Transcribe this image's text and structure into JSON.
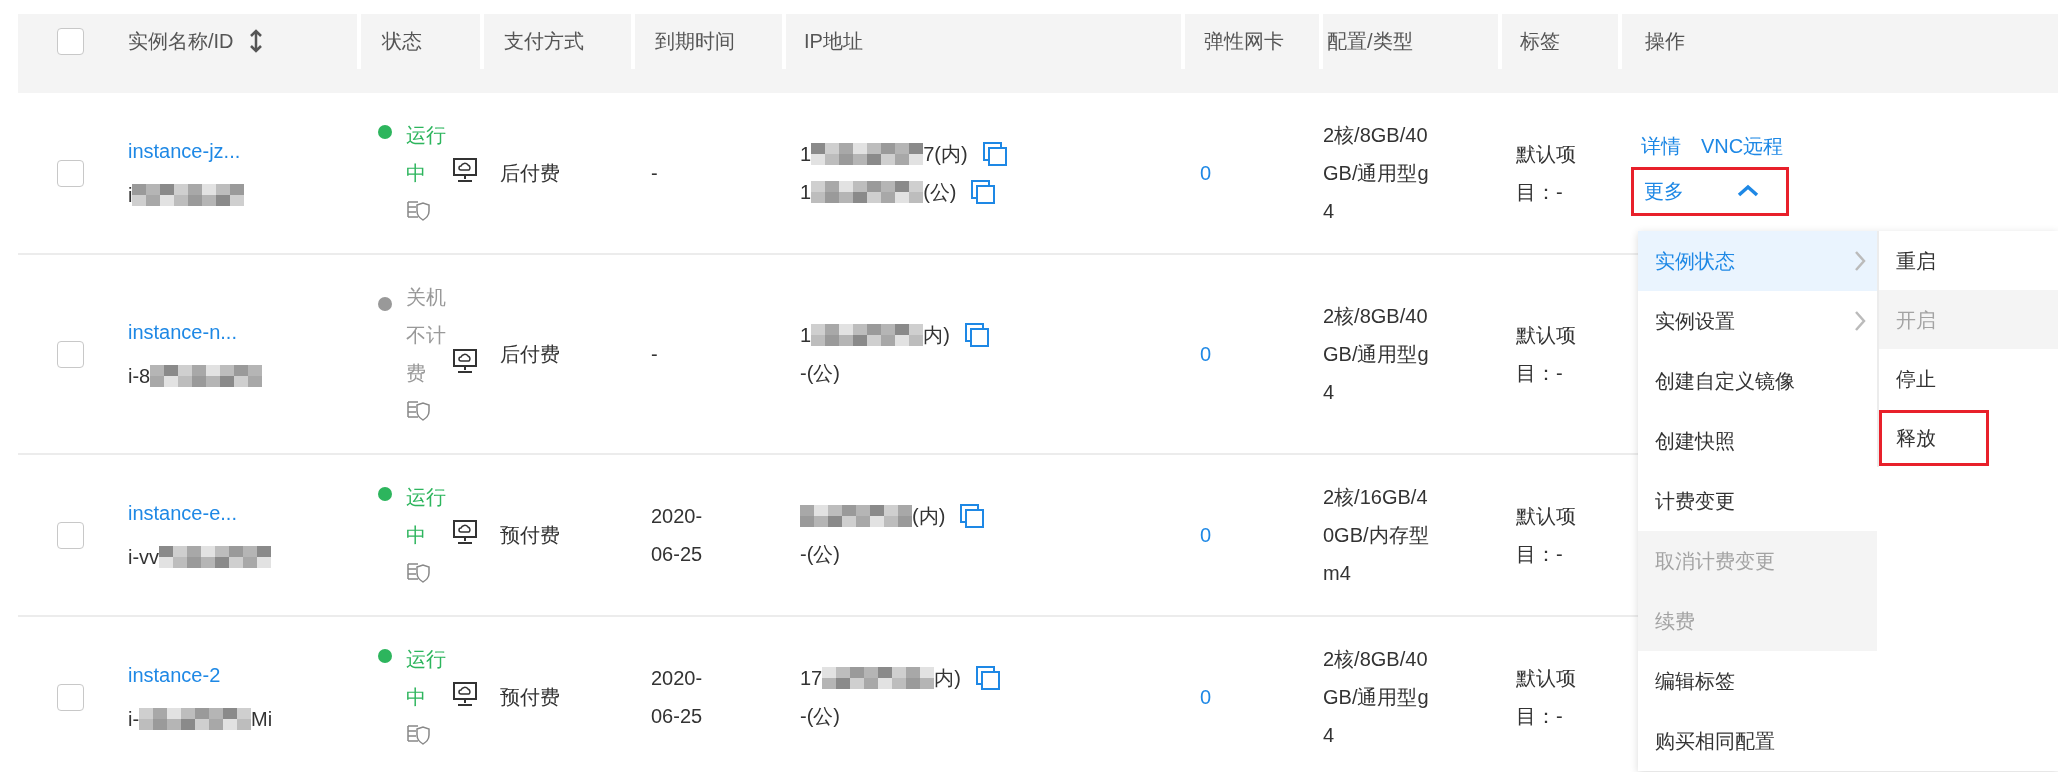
{
  "table": {
    "select_all_checked": false,
    "columns": [
      {
        "label": "实例名称/ID",
        "sortable": true
      },
      {
        "label": "状态",
        "sortable": false
      },
      {
        "label": "支付方式",
        "sortable": false
      },
      {
        "label": "到期时间",
        "sortable": false
      },
      {
        "label": "IP地址",
        "sortable": false
      },
      {
        "label": "弹性网卡",
        "sortable": false
      },
      {
        "label": "配置/类型",
        "sortable": false
      },
      {
        "label": "标签",
        "sortable": false
      },
      {
        "label": "操作",
        "sortable": false
      }
    ],
    "rows": [
      {
        "checked": false,
        "name": "instance-jz...",
        "id_before": "i",
        "id_redacted": true,
        "status": {
          "text": "运行中",
          "color": "#2db55d"
        },
        "payment": "后付费",
        "expiry": "-",
        "ips": [
          {
            "before": "1",
            "redacted": true,
            "after": "7(内)",
            "copyable": true
          },
          {
            "before": "1",
            "redacted": true,
            "after": "(公)",
            "copyable": true
          }
        ],
        "eni": "0",
        "config": "2核/8GB/40GB/通用型g4",
        "tags": "默认项目：-",
        "actions": [
          {
            "kind": "link",
            "label": "详情"
          },
          {
            "kind": "link",
            "label": "VNC远程"
          },
          {
            "kind": "more",
            "label": "更多",
            "expanded": true,
            "highlighted": true
          }
        ]
      },
      {
        "checked": false,
        "name": "instance-n...",
        "id_before": "i-8",
        "id_redacted": true,
        "status": {
          "text": "关机不计费",
          "color": "#999999"
        },
        "payment": "后付费",
        "expiry": "-",
        "ips": [
          {
            "before": "1",
            "redacted": true,
            "after": "内)",
            "copyable": true
          },
          {
            "before": "-(公)",
            "redacted": false,
            "copyable": false
          }
        ],
        "eni": "0",
        "config": "2核/8GB/40GB/通用型g4",
        "tags": "默认项目：-"
      },
      {
        "checked": false,
        "name": "instance-e...",
        "id_before": "i-vv",
        "id_redacted": true,
        "status": {
          "text": "运行中",
          "color": "#2db55d"
        },
        "payment": "预付费",
        "expiry": "2020-06-25",
        "ips": [
          {
            "redacted": true,
            "after": "(内)",
            "copyable": true
          },
          {
            "before": "-(公)",
            "redacted": false,
            "copyable": false
          }
        ],
        "eni": "0",
        "config": "2核/16GB/40GB/内存型m4",
        "tags": "默认项目：-"
      },
      {
        "checked": false,
        "name": "instance-2",
        "id_before": "i-",
        "id_redacted": true,
        "id_after": "Mi",
        "status": {
          "text": "运行中",
          "color": "#2db55d"
        },
        "payment": "预付费",
        "expiry": "2020-06-25",
        "ips": [
          {
            "before": "17",
            "redacted": true,
            "after": "内)",
            "copyable": true
          },
          {
            "before": "-(公)",
            "redacted": false,
            "copyable": false
          }
        ],
        "eni": "0",
        "config": "2核/8GB/40GB/通用型g4",
        "tags": "默认项目：-"
      }
    ]
  },
  "dropdown_menu": {
    "items": [
      {
        "label": "实例状态",
        "selected": true,
        "disabled": false,
        "has_submenu": true
      },
      {
        "label": "实例设置",
        "selected": false,
        "disabled": false,
        "has_submenu": true
      },
      {
        "label": "创建自定义镜像",
        "selected": false,
        "disabled": false,
        "has_submenu": false
      },
      {
        "label": "创建快照",
        "selected": false,
        "disabled": false,
        "has_submenu": false
      },
      {
        "label": "计费变更",
        "selected": false,
        "disabled": false,
        "has_submenu": false
      },
      {
        "label": "取消计费变更",
        "selected": false,
        "disabled": true,
        "has_submenu": false
      },
      {
        "label": "续费",
        "selected": false,
        "disabled": true,
        "has_submenu": false
      },
      {
        "label": "编辑标签",
        "selected": false,
        "disabled": false,
        "has_submenu": false
      },
      {
        "label": "购买相同配置",
        "selected": false,
        "disabled": false,
        "has_submenu": false
      }
    ],
    "submenu": [
      {
        "label": "重启",
        "disabled": false,
        "highlighted": false
      },
      {
        "label": "开启",
        "disabled": true,
        "highlighted": false
      },
      {
        "label": "停止",
        "disabled": false,
        "highlighted": false
      },
      {
        "label": "释放",
        "disabled": false,
        "highlighted": true
      }
    ]
  }
}
